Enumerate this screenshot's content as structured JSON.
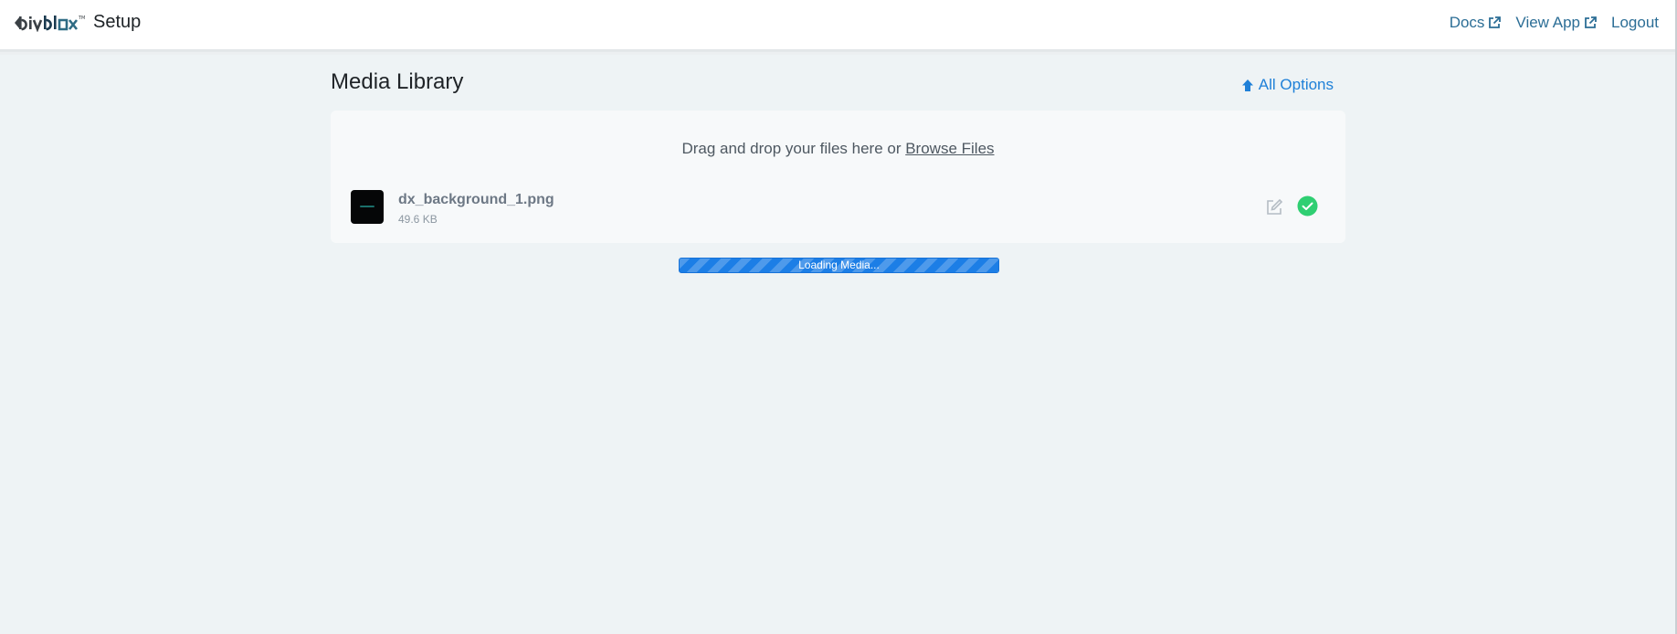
{
  "header": {
    "logo_text": "divblox™",
    "brand_label": "Setup",
    "links": [
      {
        "label": "Docs",
        "icon": "external-link-icon"
      },
      {
        "label": "View App",
        "icon": "external-link-icon"
      },
      {
        "label": "Logout"
      }
    ]
  },
  "page": {
    "title": "Media Library",
    "all_options_label": "All Options",
    "all_options_icon": "arrow-up-icon"
  },
  "uploader": {
    "drop_hint": "Drag and drop your files here or ",
    "browse_label": "Browse Files",
    "files": [
      {
        "name": "dx_background_1.png",
        "size": "49.6 KB",
        "status": "complete"
      }
    ]
  },
  "loading": {
    "label": "Loading Media...",
    "progress": 1.0
  },
  "colors": {
    "accent": "#1f80d8",
    "nav_link": "#2c6e96",
    "success": "#2fcf72",
    "progress_bar": "#1c7ee6",
    "page_bg": "#eef3f5"
  }
}
